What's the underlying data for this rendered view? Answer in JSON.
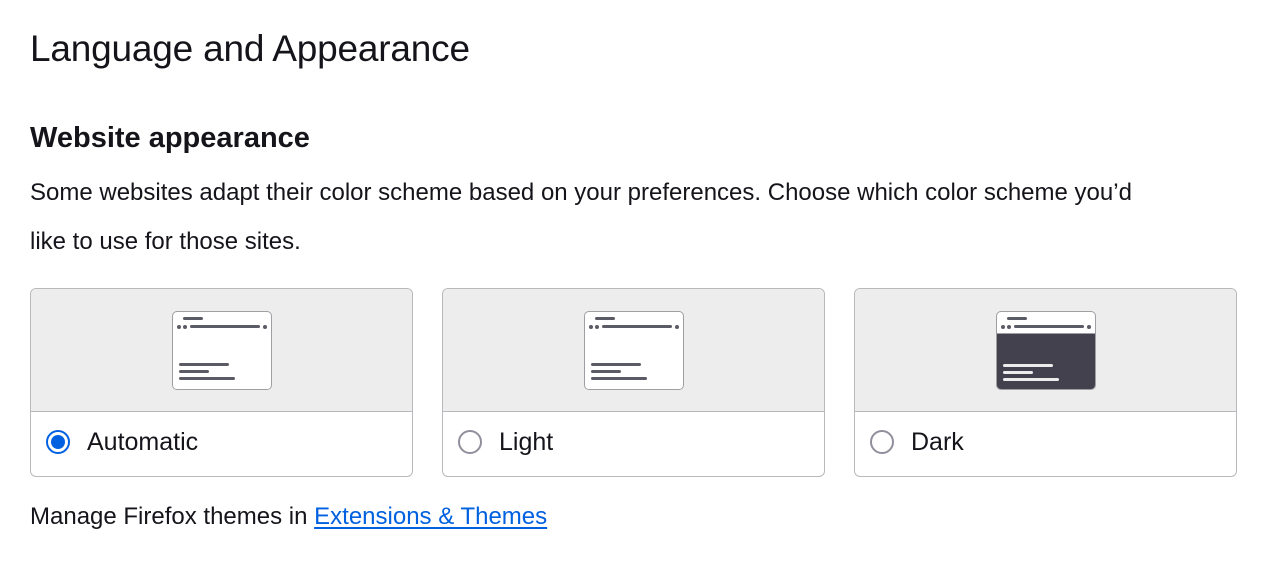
{
  "page": {
    "title": "Language and Appearance"
  },
  "website_appearance": {
    "heading": "Website appearance",
    "description": "Some websites adapt their color scheme based on your preferences. Choose which color scheme you’d like to use for those sites.",
    "options": [
      {
        "label": "Automatic",
        "checked": true,
        "preview": "light-window-icon"
      },
      {
        "label": "Light",
        "checked": false,
        "preview": "light-window-icon"
      },
      {
        "label": "Dark",
        "checked": false,
        "preview": "dark-window-icon"
      }
    ]
  },
  "manage": {
    "prefix": "Manage Firefox themes in ",
    "link": "Extensions & Themes"
  },
  "colors": {
    "accent": "#0061e0",
    "card_border": "#b9b9bd",
    "preview_bg": "#ededee",
    "dark_window": "#42414d"
  }
}
